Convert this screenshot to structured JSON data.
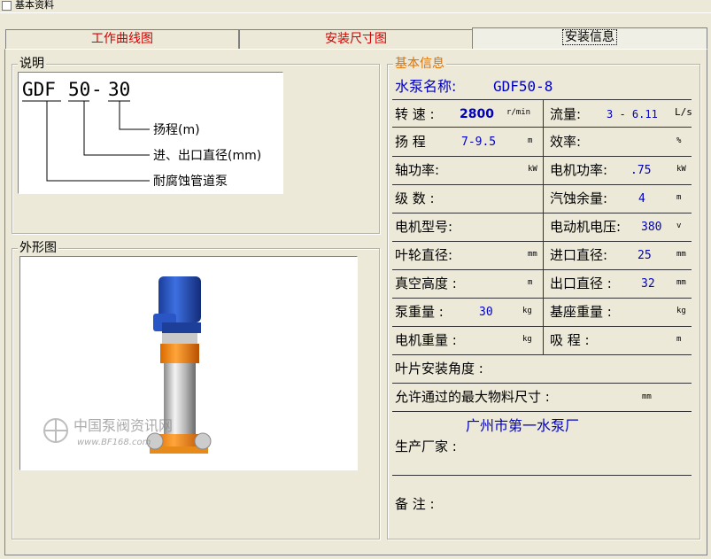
{
  "window": {
    "title": "基本资料"
  },
  "tabs": [
    {
      "label": "工作曲线图"
    },
    {
      "label": "安装尺寸图"
    },
    {
      "label": "安装信息"
    }
  ],
  "explain": {
    "group_label": "说明",
    "model_prefix": "GDF",
    "model_a": "50",
    "model_dash": "-",
    "model_b": "30",
    "legend_head": "扬程(m)",
    "legend_diameter": "进、出口直径(mm)",
    "legend_type": "耐腐蚀管道泵"
  },
  "shape": {
    "group_label": "外形图",
    "watermark_name": "中国泵阀资讯网",
    "watermark_url": "www.BF168.com"
  },
  "info": {
    "group_label": "基本信息",
    "pump_name_label": "水泵名称:",
    "pump_name": "GDF50-8",
    "speed": {
      "label": "转 速 :",
      "value": "2800",
      "unit": "r/min"
    },
    "flow": {
      "label": "流量:",
      "value": "3 - 6.11",
      "unit": "L/s"
    },
    "head": {
      "label": "扬 程",
      "value": "7-9.5",
      "unit": "m"
    },
    "efficiency": {
      "label": "效率:",
      "unit": "%"
    },
    "shaft_power": {
      "label": "轴功率:",
      "unit": "kW"
    },
    "motor_power": {
      "label": "电机功率:",
      "value": ".75",
      "unit": "kW"
    },
    "stages": {
      "label": "级 数 :"
    },
    "npsh": {
      "label": "汽蚀余量:",
      "value": "4",
      "unit": "m"
    },
    "motor_model": {
      "label": "电机型号:"
    },
    "motor_voltage": {
      "label": "电动机电压:",
      "value": "380",
      "unit": "v"
    },
    "impeller_dia": {
      "label": "叶轮直径:",
      "unit": "mm"
    },
    "inlet_dia": {
      "label": "进口直径:",
      "value": "25",
      "unit": "mm"
    },
    "vacuum_height": {
      "label": "真空高度 :",
      "unit": "m"
    },
    "outlet_dia": {
      "label": "出口直径 :",
      "value": "32",
      "unit": "mm"
    },
    "pump_weight": {
      "label": "泵重量 :",
      "value": "30",
      "unit": "kg"
    },
    "base_weight": {
      "label": "基座重量 :",
      "unit": "kg"
    },
    "motor_weight": {
      "label": "电机重量 :",
      "unit": "kg"
    },
    "suction": {
      "label": "吸 程 :",
      "unit": "m"
    },
    "blade_angle": {
      "label": "叶片安装角度 :"
    },
    "max_particle": {
      "label": "允许通过的最大物料尺寸 :",
      "unit": "mm"
    },
    "manufacturer_name": "广州市第一水泵厂",
    "manufacturer_label": "生产厂家 :",
    "remark_label": "备 注 :"
  },
  "colors": {
    "tab_text": "#d00000",
    "value_blue": "#0000c0",
    "group_label_orange": "#e07000"
  }
}
